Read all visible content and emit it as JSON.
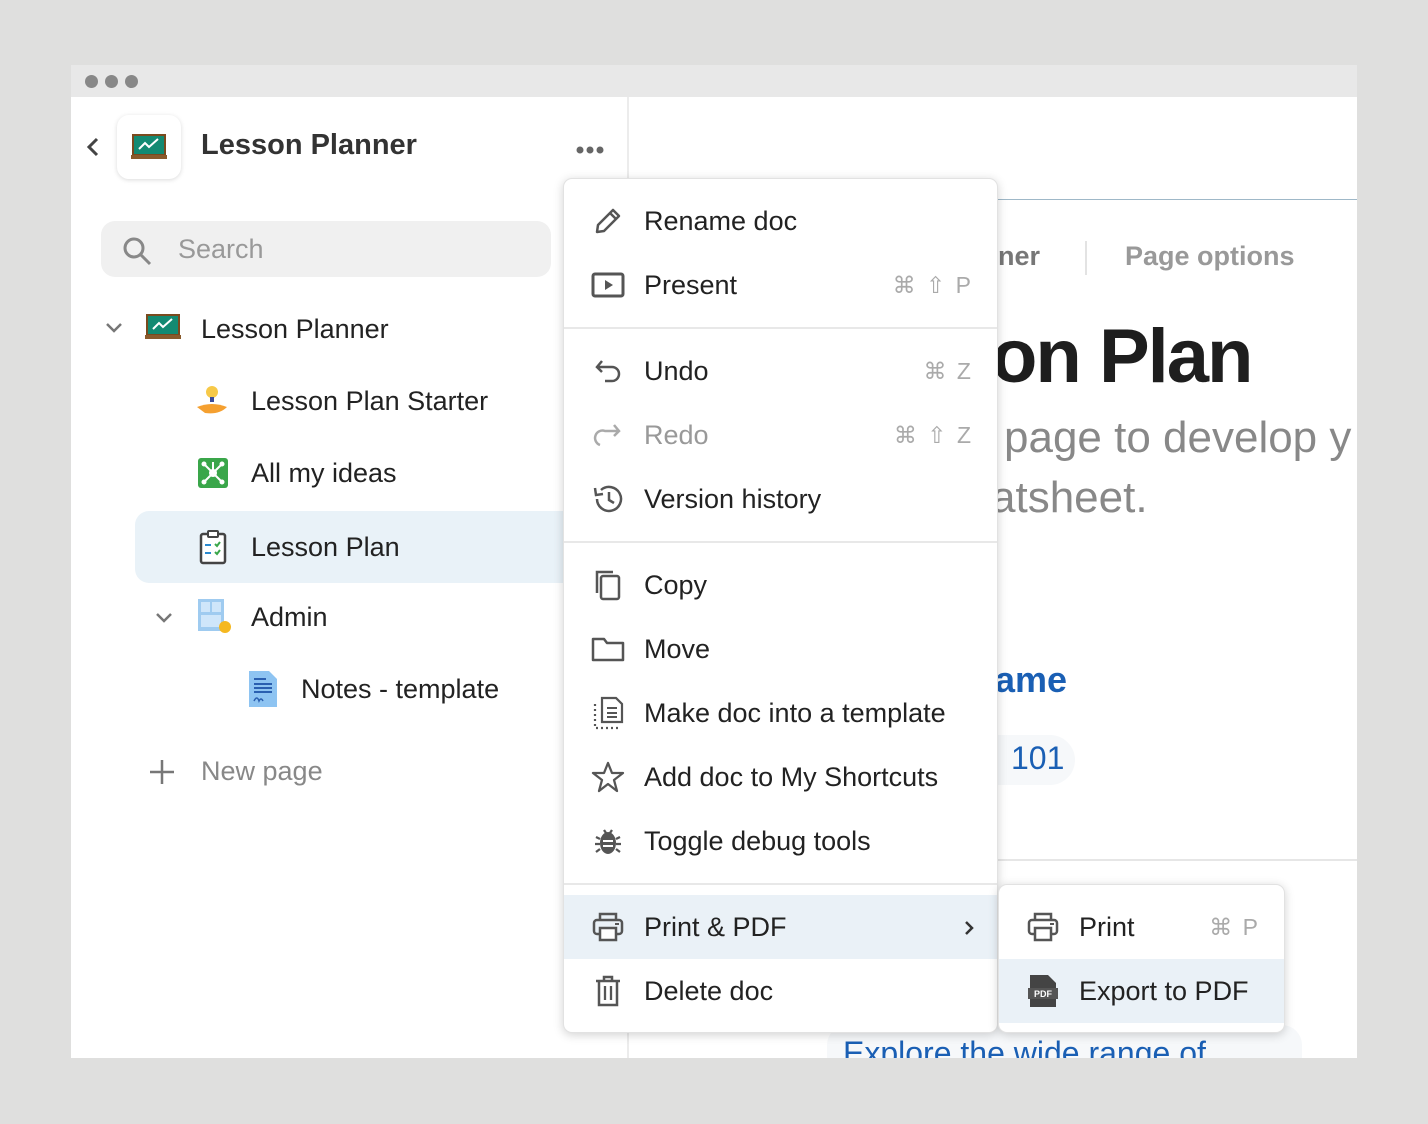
{
  "sidebar": {
    "title": "Lesson Planner",
    "search_placeholder": "Search",
    "items": [
      {
        "label": "Lesson Planner",
        "icon": "chalkboard-icon"
      },
      {
        "label": "Lesson Plan Starter",
        "icon": "lightbulb-hand-icon"
      },
      {
        "label": "All my ideas",
        "icon": "network-icon"
      },
      {
        "label": "Lesson Plan",
        "icon": "clipboard-icon",
        "selected": true
      },
      {
        "label": "Admin",
        "icon": "layout-gear-icon"
      },
      {
        "label": "Notes - template",
        "icon": "signed-document-icon"
      }
    ],
    "new_page": "New page"
  },
  "main": {
    "breadcrumb_fragment": "ner",
    "page_options": "Page options",
    "title_fragment": "on Plan",
    "subtitle_line1": "page to develop y",
    "subtitle_line2": "atsheet.",
    "heading_fragment": "ame",
    "chip_fragment": "101",
    "link_fragment": "Explore the wide range of"
  },
  "menu": {
    "items": [
      {
        "label": "Rename doc",
        "icon": "pencil-icon"
      },
      {
        "label": "Present",
        "icon": "present-icon",
        "shortcut": "⌘ ⇧ P"
      },
      {
        "label": "Undo",
        "icon": "undo-icon",
        "shortcut": "⌘ Z"
      },
      {
        "label": "Redo",
        "icon": "redo-icon",
        "shortcut": "⌘ ⇧ Z",
        "disabled": true
      },
      {
        "label": "Version history",
        "icon": "history-icon"
      },
      {
        "label": "Copy",
        "icon": "copy-icon"
      },
      {
        "label": "Move",
        "icon": "folder-icon"
      },
      {
        "label": "Make doc into a template",
        "icon": "template-icon"
      },
      {
        "label": "Add doc to My Shortcuts",
        "icon": "star-icon"
      },
      {
        "label": "Toggle debug tools",
        "icon": "bug-icon"
      },
      {
        "label": "Print & PDF",
        "icon": "printer-icon",
        "submenu": true
      },
      {
        "label": "Delete doc",
        "icon": "trash-icon"
      }
    ]
  },
  "submenu": {
    "items": [
      {
        "label": "Print",
        "icon": "printer-icon",
        "shortcut": "⌘ P"
      },
      {
        "label": "Export to PDF",
        "icon": "pdf-icon"
      }
    ]
  },
  "colors": {
    "accent": "#1a5fb4",
    "highlight": "#eaf1f7"
  }
}
